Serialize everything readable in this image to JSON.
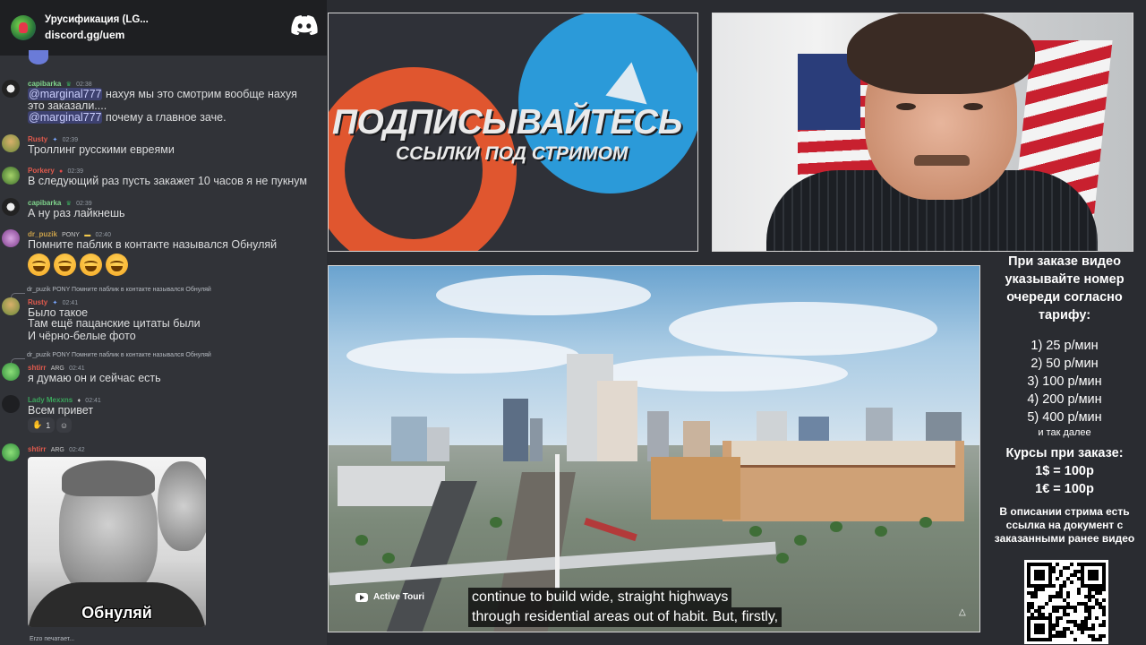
{
  "chat": {
    "server_name": "Урусификация (LG...",
    "server_invite": "discord.gg/uem",
    "messages": [
      {
        "user": "capibarka",
        "user_color": "#7fd48c",
        "time": "02:38",
        "lines": [
          {
            "mention": "@marginal777",
            "text": " нахуя мы это смотрим вообще нахуя"
          },
          {
            "mention": "",
            "text": "это заказали...."
          },
          {
            "mention": "@marginal777",
            "text": " почему а главное заче."
          }
        ]
      },
      {
        "user": "Rusty",
        "user_color": "#e15a4d",
        "time": "02:39",
        "lines": [
          {
            "mention": "",
            "text": "Троллинг русскими евреями"
          }
        ]
      },
      {
        "user": "Porkery",
        "user_color": "#e15a4d",
        "time": "02:39",
        "lines": [
          {
            "mention": "",
            "text": "В следующий раз пусть закажет 10 часов я не пукнум"
          }
        ]
      },
      {
        "user": "capibarka",
        "user_color": "#7fd48c",
        "time": "02:39",
        "lines": [
          {
            "mention": "",
            "text": "А ну раз лайкнешь"
          }
        ]
      },
      {
        "user": "dr_puzik",
        "user_color": "#c9a04a",
        "badge": "PONY",
        "time": "02:40",
        "lines": [
          {
            "mention": "",
            "text": "Помните паблик в контакте назывался Обнуляй"
          }
        ]
      },
      {
        "user": "Rusty",
        "user_color": "#e15a4d",
        "time": "02:41",
        "reply_to": "dr_puzik PONY Помните паблик в контакте назывался Обнуляй",
        "lines": [
          {
            "mention": "",
            "text": "Было такое"
          },
          {
            "mention": "",
            "text": "Там ещё пацанские цитаты были"
          },
          {
            "mention": "",
            "text": "И чёрно-белые фото"
          }
        ]
      },
      {
        "user": "shtirr",
        "user_color": "#e15a4d",
        "badge": "ARG",
        "time": "02:41",
        "reply_to": "dr_puzik PONY Помните паблик в контакте назывался Обнуляй",
        "lines": [
          {
            "mention": "",
            "text": "я думаю он и сейчас есть"
          }
        ]
      },
      {
        "user": "Lady Mexxns",
        "user_color": "#3ba55c",
        "time": "02:41",
        "lines": [
          {
            "mention": "",
            "text": "Всем привет"
          }
        ]
      },
      {
        "user": "shtirr",
        "user_color": "#e15a4d",
        "badge": "ARG",
        "time": "02:42",
        "lines": []
      }
    ],
    "reaction_count": "1",
    "meme_caption": "Обнуляй",
    "typing": "Erzo печатает..."
  },
  "promo": {
    "title": "ПОДПИСЫВАЙТЕСЬ",
    "subtitle": "ССЫЛКИ ПОД СТРИМОМ"
  },
  "video": {
    "channel": "Active Touri",
    "caption_line1": "continue to build wide, straight highways",
    "caption_line2": "through residential areas out of habit. But, firstly,"
  },
  "info": {
    "intro": "При заказе видео указывайте номер очереди согласно тарифу:",
    "tariffs": [
      "1) 25 р/мин",
      "2) 50 р/мин",
      "3) 100 р/мин",
      "4) 200 р/мин",
      "5) 400 р/мин"
    ],
    "etc": "и так далее",
    "rates_title": "Курсы при заказе:",
    "rate_usd": "1$ = 100р",
    "rate_eur": "1€ = 100р",
    "footer": "В описании стрима есть ссылка на документ с заказанными ранее видео"
  }
}
